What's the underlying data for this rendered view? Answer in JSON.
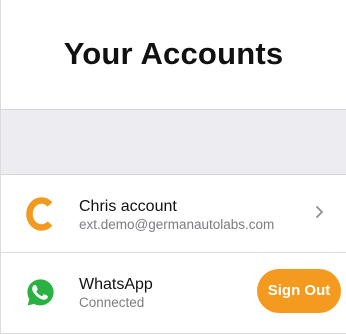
{
  "header": {
    "title": "Your Accounts"
  },
  "accounts": [
    {
      "icon": "c-logo-icon",
      "name": "Chris account",
      "detail": "ext.demo@germanautolabs.com",
      "action": "chevron-right-icon"
    },
    {
      "icon": "whatsapp-icon",
      "name": "WhatsApp",
      "detail": "Connected",
      "action_label": "Sign Out"
    }
  ],
  "colors": {
    "accent_orange": "#f39a1f",
    "whatsapp_green": "#29b141",
    "section_gray": "#ededf1"
  }
}
